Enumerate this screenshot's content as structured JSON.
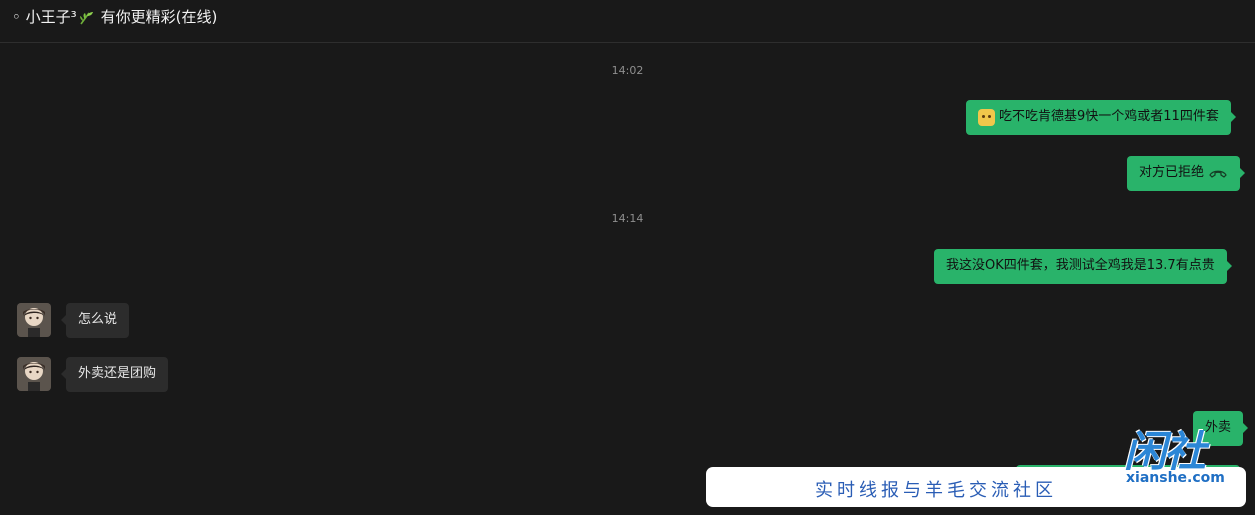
{
  "header": {
    "title_prefix": "◦ 小王子³",
    "title_suffix": "有你更精彩(在线)"
  },
  "timestamps": [
    "14:02",
    "14:14"
  ],
  "messages": [
    {
      "dir": "out",
      "text": "吃不吃肯德基9快一个鸡或者11四件套",
      "icon": "doge-emoji-icon"
    },
    {
      "dir": "out",
      "text": "对方已拒绝",
      "icon": "hangup-phone-icon"
    },
    {
      "dir": "out",
      "text": "我这没OK四件套，我测试全鸡我是13.7有点贵"
    },
    {
      "dir": "in",
      "text": "怎么说"
    },
    {
      "dir": "in",
      "text": "外卖还是团购"
    },
    {
      "dir": "out",
      "text": "外卖"
    }
  ],
  "watermark": {
    "slogan": "实时线报与羊毛交流社区",
    "logo_text": "闲社",
    "url": "xianshe.com"
  },
  "colors": {
    "background": "#191919",
    "outgoing_bubble": "#29b36a",
    "incoming_bubble": "#2c2c2c",
    "watermark_blue": "#2a5db5"
  }
}
